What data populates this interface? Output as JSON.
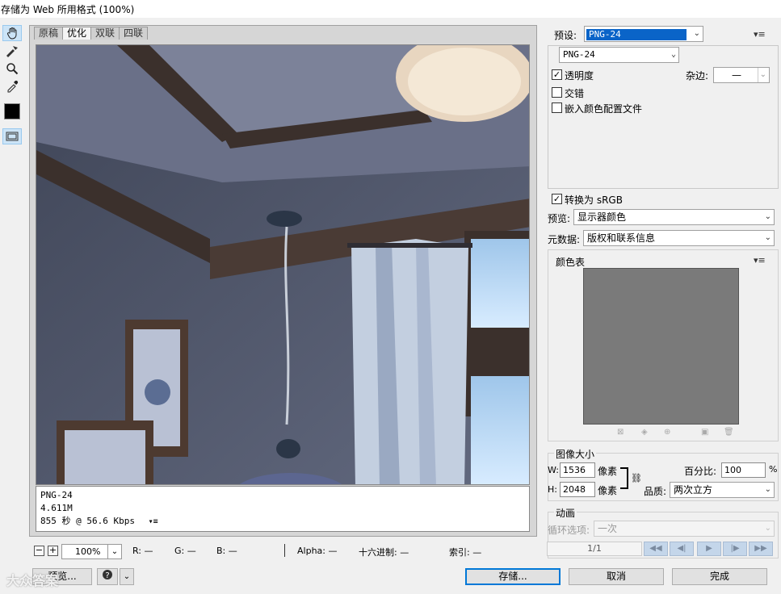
{
  "window": {
    "title": "存储为 Web 所用格式 (100%)"
  },
  "tools": {
    "hand": "hand-tool",
    "slice": "slice-select-tool",
    "zoom": "zoom-tool",
    "eyedropper": "eyedropper-tool"
  },
  "view_tabs": [
    "原稿",
    "优化",
    "双联",
    "四联"
  ],
  "image_info": {
    "format": "PNG-24",
    "size": "4.611M",
    "speed": "855 秒 @ 56.6 Kbps"
  },
  "statusbar": {
    "zoom": "100%",
    "r": "R: —",
    "g": "G: —",
    "b": "B: —",
    "alpha": "Alpha: —",
    "hex": "十六进制: —",
    "index": "索引: —"
  },
  "buttons": {
    "preview": "预览...",
    "save": "存储...",
    "cancel": "取消",
    "done": "完成"
  },
  "right_panel": {
    "preset_label": "预设:",
    "preset_value": "PNG-24",
    "format_value": "PNG-24",
    "transparency_label": "透明度",
    "transparency_checked": true,
    "matte_label": "杂边:",
    "matte_value": "—",
    "interlaced_label": "交错",
    "interlaced_checked": false,
    "embed_profile_label": "嵌入颜色配置文件",
    "embed_profile_checked": false,
    "convert_srgb_label": "转换为 sRGB",
    "convert_srgb_checked": true,
    "preview_label": "预览:",
    "preview_value": "显示器颜色",
    "metadata_label": "元数据:",
    "metadata_value": "版权和联系信息",
    "color_table_label": "颜色表",
    "image_size_label": "图像大小",
    "w_label": "W:",
    "w_value": "1536",
    "h_label": "H:",
    "h_value": "2048",
    "px_unit": "像素",
    "percent_label": "百分比:",
    "percent_value": "100",
    "percent_unit": "%",
    "quality_label": "品质:",
    "quality_value": "两次立方",
    "animation_label": "动画",
    "loop_label": "循环选项:",
    "loop_value": "一次",
    "frame_counter": "1/1"
  },
  "watermark": "大众答案",
  "colors": {
    "accent": "#0078d7",
    "selection": "#0a64c8",
    "panel_bg": "#f0f0f0",
    "color_table_bg": "#7a7a7a"
  }
}
